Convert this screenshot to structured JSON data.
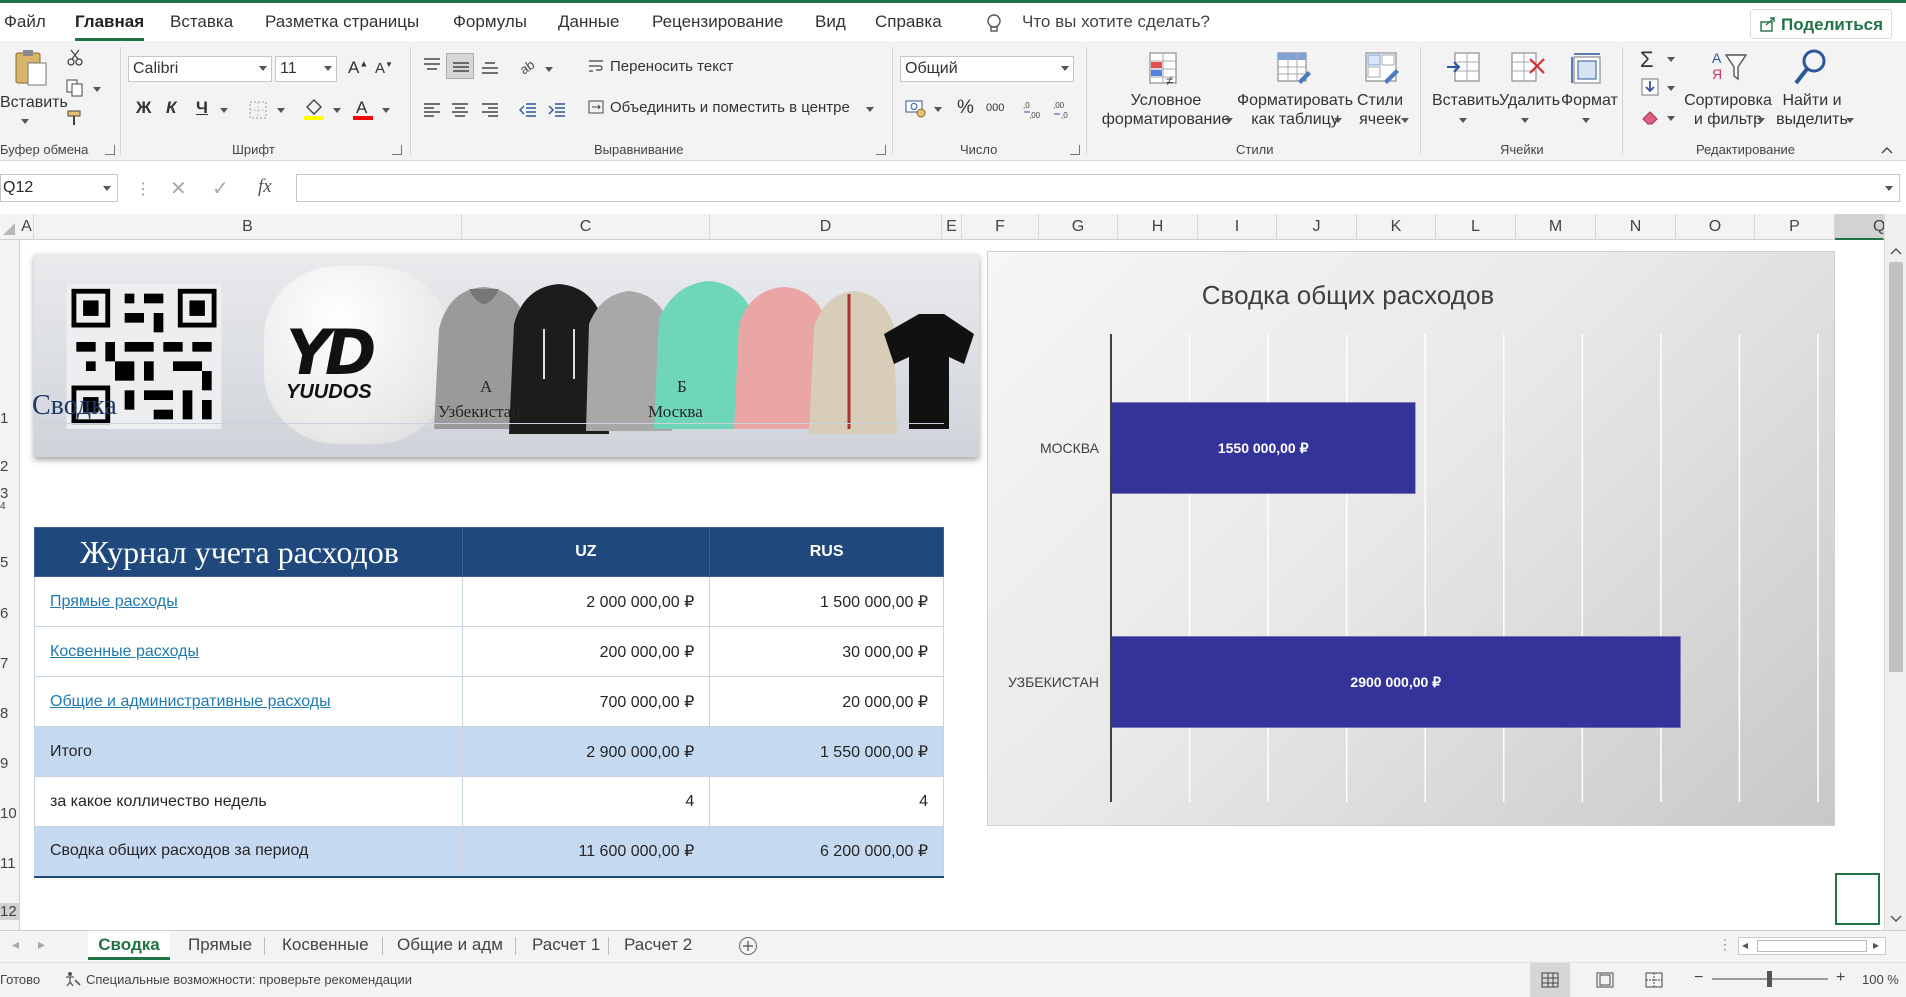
{
  "menu": {
    "tabs": [
      "Файл",
      "Главная",
      "Вставка",
      "Разметка страницы",
      "Формулы",
      "Данные",
      "Рецензирование",
      "Вид",
      "Справка"
    ],
    "active_tab": "Главная",
    "tell_me": "Что вы хотите сделать?",
    "share": "Поделиться"
  },
  "ribbon": {
    "clipboard": {
      "paste": "Вставить",
      "label": "Буфер обмена"
    },
    "font": {
      "name": "Calibri",
      "size": "11",
      "bold": "Ж",
      "italic": "К",
      "underline": "Ч",
      "label": "Шрифт"
    },
    "alignment": {
      "wrap": "Переносить текст",
      "merge": "Объединить и поместить в центре",
      "label": "Выравнивание"
    },
    "number": {
      "format": "Общий",
      "percent": "%",
      "thousands": "000",
      "label": "Число"
    },
    "styles": {
      "conditional": [
        "Условное",
        "форматирование"
      ],
      "as_table": [
        "Форматировать",
        "как таблицу"
      ],
      "cell_styles": [
        "Стили",
        "ячеек"
      ],
      "label": "Стили"
    },
    "cells": {
      "insert": "Вставить",
      "delete": "Удалить",
      "format": "Формат",
      "label": "Ячейки"
    },
    "editing": {
      "sigma": "Σ",
      "sort": [
        "Сортировка",
        "и фильтр"
      ],
      "find": [
        "Найти и",
        "выделить"
      ],
      "label": "Редактирование"
    }
  },
  "formula_bar": {
    "name_box": "Q12",
    "fx": "fx",
    "value": ""
  },
  "columns": [
    "A",
    "B",
    "C",
    "D",
    "E",
    "F",
    "G",
    "H",
    "I",
    "J",
    "K",
    "L",
    "M",
    "N",
    "O",
    "P",
    "Q"
  ],
  "rows": [
    "1",
    "2",
    "3",
    "4",
    "5",
    "6",
    "7",
    "8",
    "9",
    "10",
    "11",
    "12"
  ],
  "summary": {
    "title": "Сводка",
    "col_a_letter": "А",
    "col_b_letter": "Б",
    "col_a_name": "Узбекистан",
    "col_b_name": "Москва"
  },
  "banner": {
    "logo_letters": "YD",
    "logo_name": "YUUDOS"
  },
  "table": {
    "title": "Журнал учета расходов",
    "col1": "UZ",
    "col2": "RUS",
    "rows": [
      {
        "label": "Прямые расходы",
        "uz": "2 000 000,00 ₽",
        "rus": "1 500 000,00 ₽"
      },
      {
        "label": "Косвенные расходы",
        "uz": "200 000,00 ₽",
        "rus": "30 000,00 ₽"
      },
      {
        "label": "Общие и административные расходы",
        "uz": "700 000,00 ₽",
        "rus": "20 000,00 ₽"
      },
      {
        "label": "Итого",
        "uz": "2 900 000,00 ₽",
        "rus": "1 550 000,00 ₽"
      },
      {
        "label": "за какое колличество недель",
        "uz": "4",
        "rus": "4"
      },
      {
        "label": "Сводка общих расходов за период",
        "uz": "11 600 000,00 ₽",
        "rus": "6 200 000,00 ₽"
      }
    ]
  },
  "chart_data": {
    "type": "bar",
    "orientation": "horizontal",
    "title": "Сводка общих расходов",
    "categories": [
      "МОСКВА",
      "УЗБЕКИСТАН"
    ],
    "values": [
      1550000,
      2900000
    ],
    "data_labels": [
      "1550 000,00 ₽",
      "2900 000,00 ₽"
    ],
    "xlim": [
      0,
      3600000
    ],
    "grid": true,
    "bar_color": "#333399"
  },
  "sheets": [
    "Сводка",
    "Прямые",
    "Косвенные",
    "Общие и адм",
    "Расчет 1",
    "Расчет 2"
  ],
  "active_sheet": "Сводка",
  "status": {
    "ready": "Готово",
    "accessibility": "Специальные возможности: проверьте рекомендации",
    "zoom": "100 %"
  },
  "colors": {
    "accent": "#217346",
    "table_header": "#1f497d",
    "table_band": "#c5d9f1",
    "link": "#1f7ab0"
  }
}
